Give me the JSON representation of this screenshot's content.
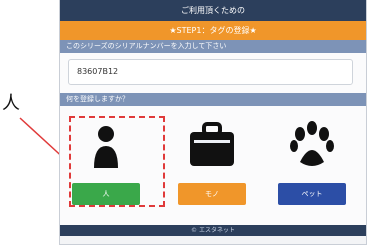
{
  "annotation": {
    "label": "人"
  },
  "app": {
    "title": "ご利用頂くための",
    "step": "★STEP1：タグの登録★"
  },
  "serial": {
    "label": "このシリーズのシリアルナンバーを入力して下さい",
    "value": "83607B12"
  },
  "target": {
    "label": "何を登録しますか？",
    "options": [
      {
        "label": "人",
        "icon": "person-icon",
        "color": "#3aa84a"
      },
      {
        "label": "モノ",
        "icon": "bag-icon",
        "color": "#f0962a"
      },
      {
        "label": "ペット",
        "icon": "paw-icon",
        "color": "#2c4ea6"
      }
    ]
  },
  "footer": {
    "text": "© エスタネット"
  },
  "colors": {
    "header": "#2c3f5c",
    "step": "#f0962a",
    "highlight": "#e03a3a"
  }
}
